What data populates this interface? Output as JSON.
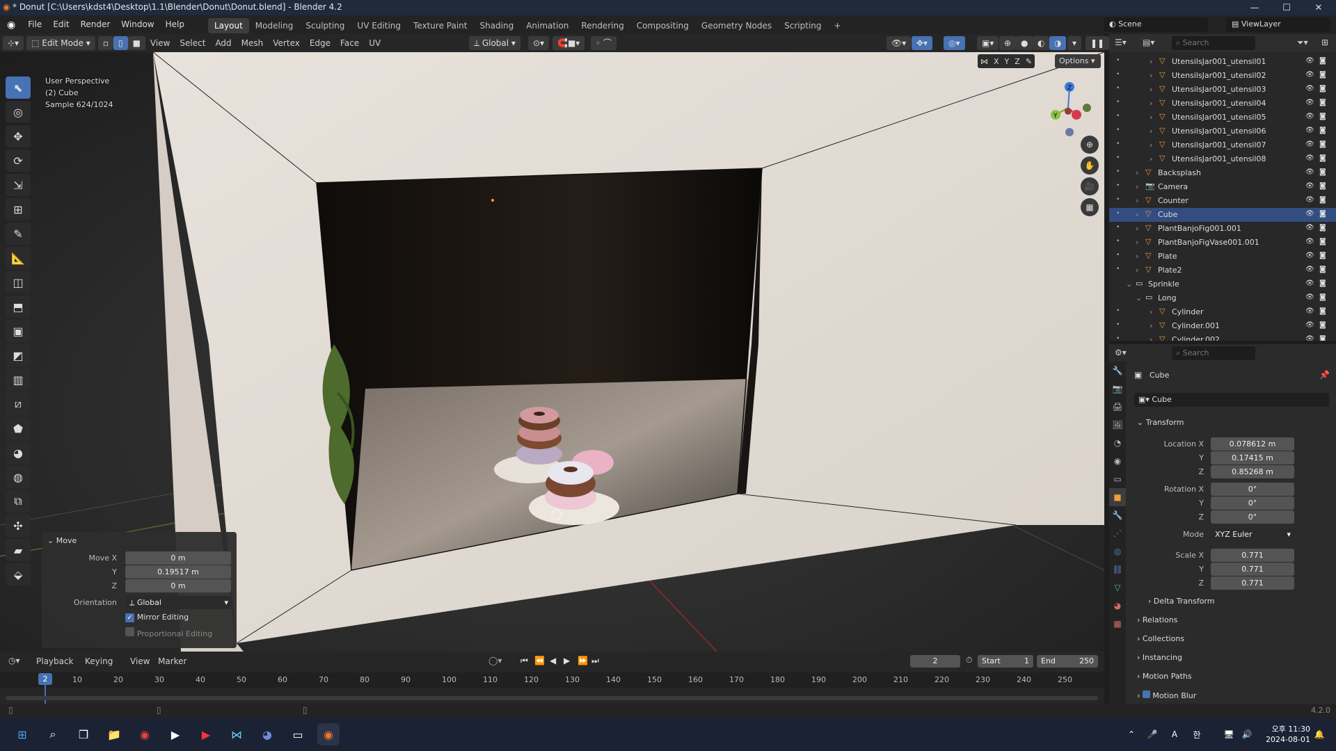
{
  "titlebar": {
    "title": "* Donut [C:\\Users\\kdst4\\Desktop\\1.1\\Blender\\Donut\\Donut.blend] - Blender 4.2",
    "minimize": "—",
    "maximize": "☐",
    "close": "✕"
  },
  "menu": {
    "items": [
      "File",
      "Edit",
      "Render",
      "Window",
      "Help"
    ],
    "workspaces": [
      "Layout",
      "Modeling",
      "Sculpting",
      "UV Editing",
      "Texture Paint",
      "Shading",
      "Animation",
      "Rendering",
      "Compositing",
      "Geometry Nodes",
      "Scripting"
    ],
    "add": "+",
    "scene": "Scene",
    "viewlayer": "ViewLayer"
  },
  "viewport_header": {
    "mode": "Edit Mode",
    "menus": [
      "View",
      "Select",
      "Add",
      "Mesh",
      "Vertex",
      "Edge",
      "Face",
      "UV"
    ],
    "orientation": "Global",
    "options": "Options",
    "axes": [
      "X",
      "Y",
      "Z"
    ]
  },
  "viewport": {
    "info_line1": "User Perspective",
    "info_line2": "(2) Cube",
    "info_line3": "Sample 624/1024"
  },
  "move_panel": {
    "title": "Move",
    "x_label": "Move X",
    "x_val": "0 m",
    "y_label": "Y",
    "y_val": "0.19517 m",
    "z_label": "Z",
    "z_val": "0 m",
    "orient_label": "Orientation",
    "orient_val": "Global",
    "mirror": "Mirror Editing",
    "proportional": "Proportional Editing"
  },
  "outliner": {
    "search_placeholder": "Search",
    "rows": [
      {
        "name": "UtensilsJar001_utensil01"
      },
      {
        "name": "UtensilsJar001_utensil02"
      },
      {
        "name": "UtensilsJar001_utensil03"
      },
      {
        "name": "UtensilsJar001_utensil04"
      },
      {
        "name": "UtensilsJar001_utensil05"
      },
      {
        "name": "UtensilsJar001_utensil06"
      },
      {
        "name": "UtensilsJar001_utensil07"
      },
      {
        "name": "UtensilsJar001_utensil08"
      },
      {
        "name": "Backsplash"
      },
      {
        "name": "Camera"
      },
      {
        "name": "Counter"
      },
      {
        "name": "Cube"
      },
      {
        "name": "PlantBanjoFig001.001"
      },
      {
        "name": "PlantBanjoFigVase001.001"
      },
      {
        "name": "Plate"
      },
      {
        "name": "Plate2"
      },
      {
        "name": "Sprinkle"
      },
      {
        "name": "Long"
      },
      {
        "name": "Cylinder"
      },
      {
        "name": "Cylinder.001"
      },
      {
        "name": "Cylinder.002"
      }
    ]
  },
  "properties": {
    "search_placeholder": "Search",
    "object_name": "Cube",
    "object_field": "Cube",
    "transform": "Transform",
    "loc_label": "Location X",
    "loc_x": "0.078612 m",
    "loc_y": "0.17415 m",
    "loc_z": "0.85268 m",
    "rot_label": "Rotation X",
    "rot_x": "0°",
    "rot_y": "0°",
    "rot_z": "0°",
    "mode_label": "Mode",
    "mode_val": "XYZ Euler",
    "scale_label": "Scale X",
    "scale_x": "0.771",
    "scale_y": "0.771",
    "scale_z": "0.771",
    "y": "Y",
    "z": "Z",
    "sections": [
      "Delta Transform",
      "Relations",
      "Collections",
      "Instancing",
      "Motion Paths",
      "Motion Blur"
    ]
  },
  "timeline": {
    "menus": [
      "Playback",
      "Keying",
      "View",
      "Marker"
    ],
    "frame": "2",
    "start_label": "Start",
    "start": "1",
    "end_label": "End",
    "end": "250",
    "ticks": [
      "10",
      "20",
      "30",
      "40",
      "50",
      "60",
      "70",
      "80",
      "90",
      "100",
      "110",
      "120",
      "130",
      "140",
      "150",
      "160",
      "170",
      "180",
      "190",
      "200",
      "210",
      "220",
      "230",
      "240",
      "250"
    ],
    "current": "2"
  },
  "status": {
    "version": "4.2.0"
  },
  "taskbar": {
    "time": "오후 11:30",
    "date": "2024-08-01"
  }
}
